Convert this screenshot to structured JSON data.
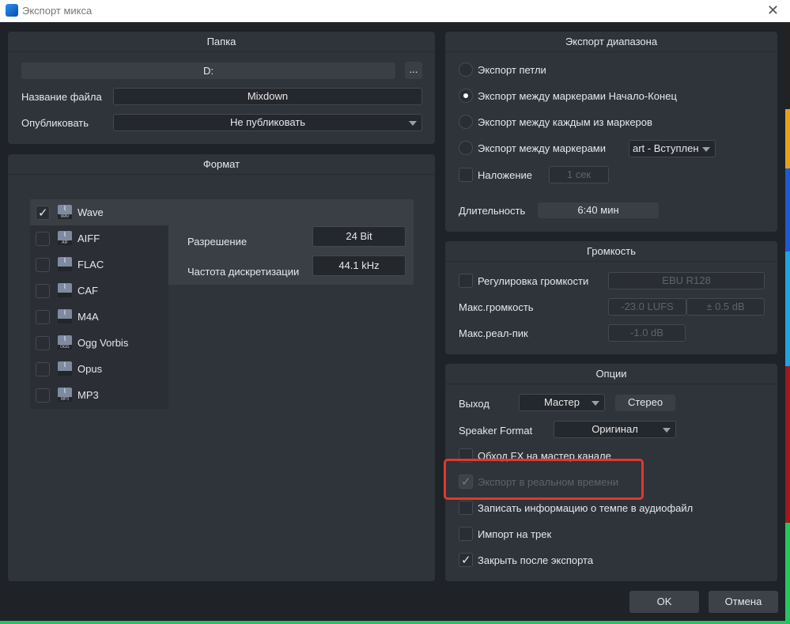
{
  "window": {
    "title": "Экспорт микса",
    "close_icon": "close-icon"
  },
  "folder": {
    "header": "Папка",
    "path": "D:",
    "browse": "...",
    "filename_label": "Название файла",
    "filename": "Mixdown",
    "publish_label": "Опубликовать",
    "publish_value": "Не публиковать"
  },
  "format": {
    "header": "Формат",
    "items": [
      {
        "label": "Wave",
        "tag": "WAV",
        "checked": true
      },
      {
        "label": "AIFF",
        "tag": "AIF",
        "checked": false
      },
      {
        "label": "FLAC",
        "tag": "",
        "checked": false
      },
      {
        "label": "CAF",
        "tag": "",
        "checked": false
      },
      {
        "label": "M4A",
        "tag": "",
        "checked": false
      },
      {
        "label": "Ogg Vorbis",
        "tag": "OGG",
        "checked": false
      },
      {
        "label": "Opus",
        "tag": "",
        "checked": false
      },
      {
        "label": "MP3",
        "tag": "MP3",
        "checked": false
      }
    ],
    "resolution_label": "Разрешение",
    "resolution": "24 Bit",
    "samplerate_label": "Частота дискретизации",
    "samplerate": "44.1 kHz"
  },
  "range": {
    "header": "Экспорт диапазона",
    "options": [
      "Экспорт петли",
      "Экспорт между маркерами Начало-Конец",
      "Экспорт между каждым из маркеров",
      "Экспорт между маркерами"
    ],
    "selected": 1,
    "marker_value": "art - Вступлен",
    "overlap_label": "Наложение",
    "overlap_value": "1 сек",
    "duration_label": "Длительность",
    "duration": "6:40 мин"
  },
  "volume": {
    "header": "Громкость",
    "normalize_label": "Регулировка громкости",
    "normalize_value": "EBU R128",
    "max_loudness_label": "Макс.громкость",
    "max_loudness": "-23.0 LUFS",
    "tolerance": "± 0.5 dB",
    "true_peak_label": "Макс.реал-пик",
    "true_peak": "-1.0 dB"
  },
  "options": {
    "header": "Опции",
    "output_label": "Выход",
    "output_value": "Мастер",
    "stereo": "Стерео",
    "speaker_label": "Speaker Format",
    "speaker_value": "Оригинал",
    "checks": [
      {
        "label": "Обход FX на мастер канале",
        "checked": false,
        "disabled": false
      },
      {
        "label": "Экспорт в реальном времени",
        "checked": true,
        "disabled": true
      },
      {
        "label": "Записать информацию о темпе в аудиофайл",
        "checked": false,
        "disabled": false
      },
      {
        "label": "Импорт на трек",
        "checked": false,
        "disabled": false
      },
      {
        "label": "Закрыть после экспорта",
        "checked": true,
        "disabled": false
      }
    ]
  },
  "footer": {
    "ok": "OK",
    "cancel": "Отмена"
  },
  "colors": {
    "highlight": "#e0392e",
    "panel": "#2f333a",
    "background": "#1f2227"
  }
}
